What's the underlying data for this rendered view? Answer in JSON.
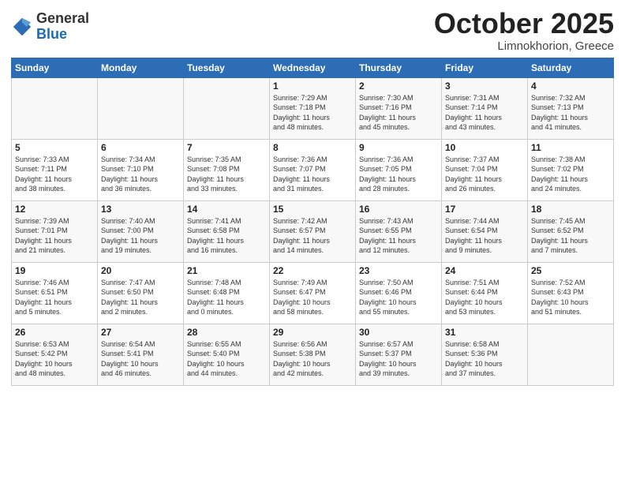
{
  "logo": {
    "general": "General",
    "blue": "Blue"
  },
  "header": {
    "month": "October 2025",
    "location": "Limnokhorion, Greece"
  },
  "days_of_week": [
    "Sunday",
    "Monday",
    "Tuesday",
    "Wednesday",
    "Thursday",
    "Friday",
    "Saturday"
  ],
  "weeks": [
    [
      {
        "day": "",
        "info": ""
      },
      {
        "day": "",
        "info": ""
      },
      {
        "day": "",
        "info": ""
      },
      {
        "day": "1",
        "info": "Sunrise: 7:29 AM\nSunset: 7:18 PM\nDaylight: 11 hours\nand 48 minutes."
      },
      {
        "day": "2",
        "info": "Sunrise: 7:30 AM\nSunset: 7:16 PM\nDaylight: 11 hours\nand 45 minutes."
      },
      {
        "day": "3",
        "info": "Sunrise: 7:31 AM\nSunset: 7:14 PM\nDaylight: 11 hours\nand 43 minutes."
      },
      {
        "day": "4",
        "info": "Sunrise: 7:32 AM\nSunset: 7:13 PM\nDaylight: 11 hours\nand 41 minutes."
      }
    ],
    [
      {
        "day": "5",
        "info": "Sunrise: 7:33 AM\nSunset: 7:11 PM\nDaylight: 11 hours\nand 38 minutes."
      },
      {
        "day": "6",
        "info": "Sunrise: 7:34 AM\nSunset: 7:10 PM\nDaylight: 11 hours\nand 36 minutes."
      },
      {
        "day": "7",
        "info": "Sunrise: 7:35 AM\nSunset: 7:08 PM\nDaylight: 11 hours\nand 33 minutes."
      },
      {
        "day": "8",
        "info": "Sunrise: 7:36 AM\nSunset: 7:07 PM\nDaylight: 11 hours\nand 31 minutes."
      },
      {
        "day": "9",
        "info": "Sunrise: 7:36 AM\nSunset: 7:05 PM\nDaylight: 11 hours\nand 28 minutes."
      },
      {
        "day": "10",
        "info": "Sunrise: 7:37 AM\nSunset: 7:04 PM\nDaylight: 11 hours\nand 26 minutes."
      },
      {
        "day": "11",
        "info": "Sunrise: 7:38 AM\nSunset: 7:02 PM\nDaylight: 11 hours\nand 24 minutes."
      }
    ],
    [
      {
        "day": "12",
        "info": "Sunrise: 7:39 AM\nSunset: 7:01 PM\nDaylight: 11 hours\nand 21 minutes."
      },
      {
        "day": "13",
        "info": "Sunrise: 7:40 AM\nSunset: 7:00 PM\nDaylight: 11 hours\nand 19 minutes."
      },
      {
        "day": "14",
        "info": "Sunrise: 7:41 AM\nSunset: 6:58 PM\nDaylight: 11 hours\nand 16 minutes."
      },
      {
        "day": "15",
        "info": "Sunrise: 7:42 AM\nSunset: 6:57 PM\nDaylight: 11 hours\nand 14 minutes."
      },
      {
        "day": "16",
        "info": "Sunrise: 7:43 AM\nSunset: 6:55 PM\nDaylight: 11 hours\nand 12 minutes."
      },
      {
        "day": "17",
        "info": "Sunrise: 7:44 AM\nSunset: 6:54 PM\nDaylight: 11 hours\nand 9 minutes."
      },
      {
        "day": "18",
        "info": "Sunrise: 7:45 AM\nSunset: 6:52 PM\nDaylight: 11 hours\nand 7 minutes."
      }
    ],
    [
      {
        "day": "19",
        "info": "Sunrise: 7:46 AM\nSunset: 6:51 PM\nDaylight: 11 hours\nand 5 minutes."
      },
      {
        "day": "20",
        "info": "Sunrise: 7:47 AM\nSunset: 6:50 PM\nDaylight: 11 hours\nand 2 minutes."
      },
      {
        "day": "21",
        "info": "Sunrise: 7:48 AM\nSunset: 6:48 PM\nDaylight: 11 hours\nand 0 minutes."
      },
      {
        "day": "22",
        "info": "Sunrise: 7:49 AM\nSunset: 6:47 PM\nDaylight: 10 hours\nand 58 minutes."
      },
      {
        "day": "23",
        "info": "Sunrise: 7:50 AM\nSunset: 6:46 PM\nDaylight: 10 hours\nand 55 minutes."
      },
      {
        "day": "24",
        "info": "Sunrise: 7:51 AM\nSunset: 6:44 PM\nDaylight: 10 hours\nand 53 minutes."
      },
      {
        "day": "25",
        "info": "Sunrise: 7:52 AM\nSunset: 6:43 PM\nDaylight: 10 hours\nand 51 minutes."
      }
    ],
    [
      {
        "day": "26",
        "info": "Sunrise: 6:53 AM\nSunset: 5:42 PM\nDaylight: 10 hours\nand 48 minutes."
      },
      {
        "day": "27",
        "info": "Sunrise: 6:54 AM\nSunset: 5:41 PM\nDaylight: 10 hours\nand 46 minutes."
      },
      {
        "day": "28",
        "info": "Sunrise: 6:55 AM\nSunset: 5:40 PM\nDaylight: 10 hours\nand 44 minutes."
      },
      {
        "day": "29",
        "info": "Sunrise: 6:56 AM\nSunset: 5:38 PM\nDaylight: 10 hours\nand 42 minutes."
      },
      {
        "day": "30",
        "info": "Sunrise: 6:57 AM\nSunset: 5:37 PM\nDaylight: 10 hours\nand 39 minutes."
      },
      {
        "day": "31",
        "info": "Sunrise: 6:58 AM\nSunset: 5:36 PM\nDaylight: 10 hours\nand 37 minutes."
      },
      {
        "day": "",
        "info": ""
      }
    ]
  ]
}
